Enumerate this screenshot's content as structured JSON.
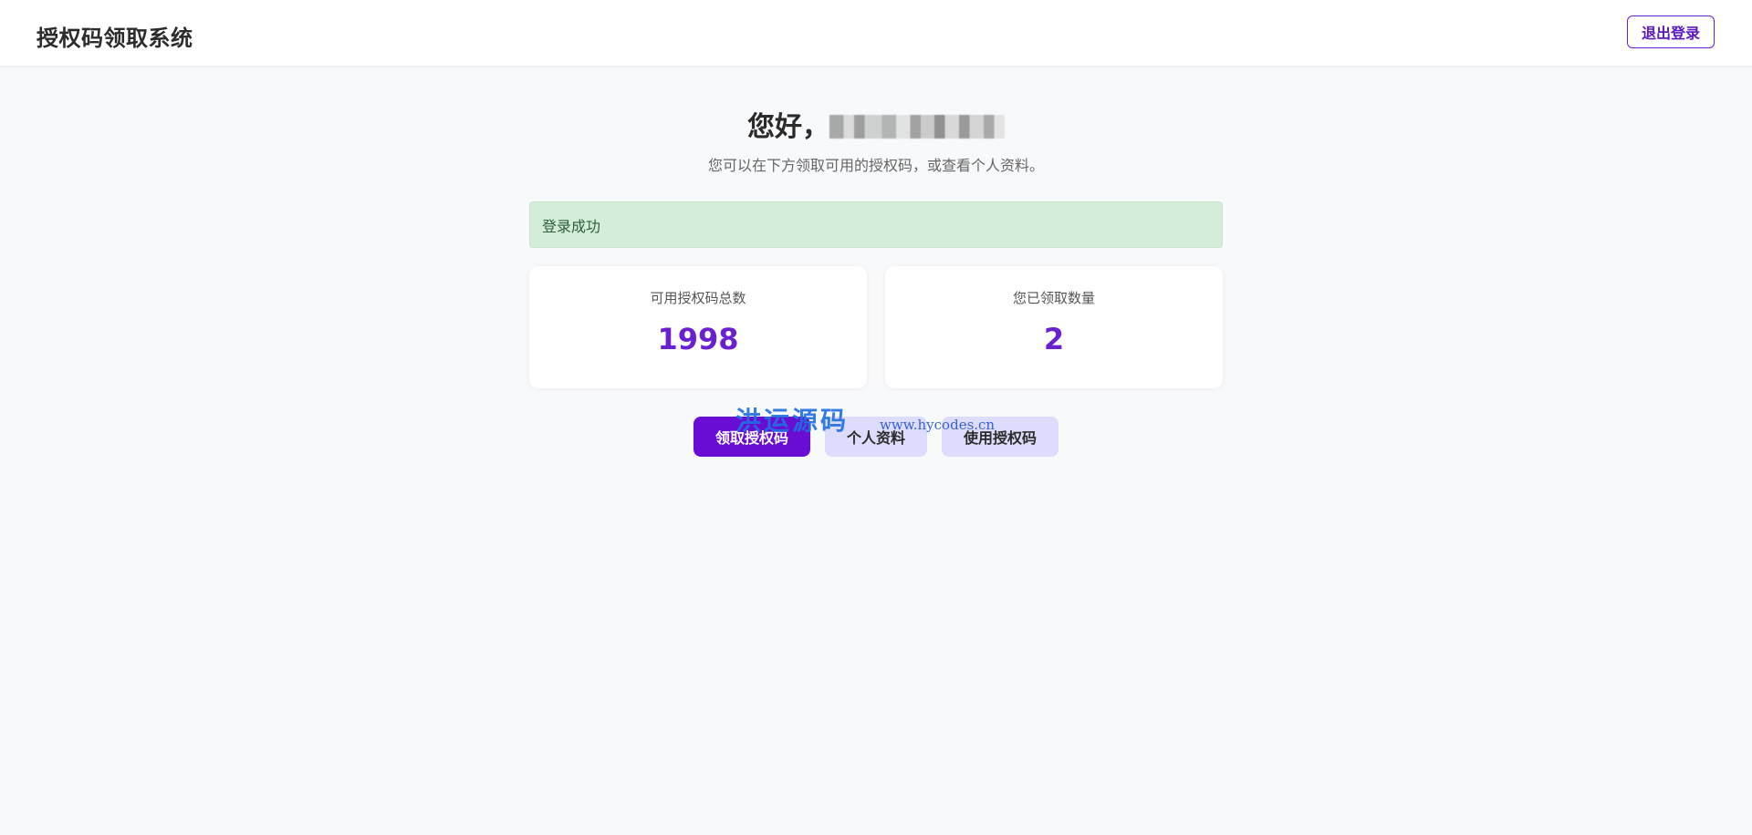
{
  "header": {
    "app_title": "授权码领取系统",
    "logout_label": "退出登录"
  },
  "main": {
    "greeting_prefix": "您好，",
    "subtitle": "您可以在下方领取可用的授权码，或查看个人资料。",
    "alert_message": "登录成功",
    "stats": [
      {
        "label": "可用授权码总数",
        "value": "1998"
      },
      {
        "label": "您已领取数量",
        "value": "2"
      }
    ],
    "actions": {
      "claim_label": "领取授权码",
      "profile_label": "个人资料",
      "use_label": "使用授权码"
    }
  },
  "watermark": {
    "text": "洪运源码",
    "url": "www.hycodes.cn"
  },
  "colors": {
    "accent": "#6a0dd4",
    "alert_bg": "#d4edda",
    "secondary_btn_bg": "#dedcfc",
    "page_bg": "#f8f9fb"
  }
}
